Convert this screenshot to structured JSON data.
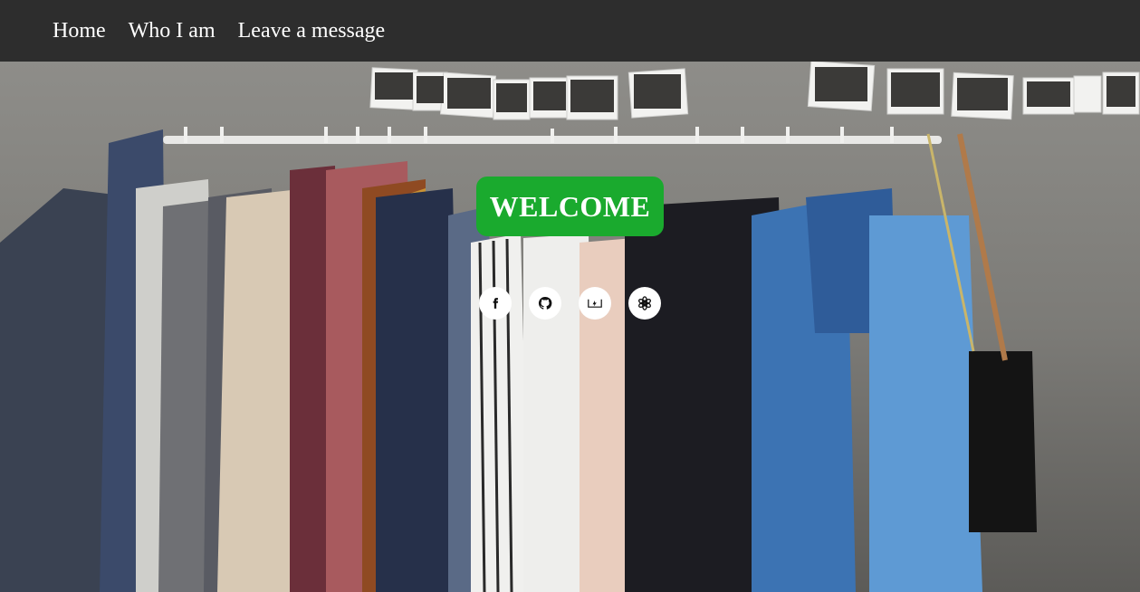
{
  "nav": {
    "items": [
      {
        "label": "Home"
      },
      {
        "label": "Who I am"
      },
      {
        "label": "Leave a message"
      }
    ]
  },
  "hero": {
    "welcome_label": "WELCOME",
    "accent_color": "#1aaa2e",
    "social_icons": [
      "facebook-icon",
      "github-icon",
      "codepen-icon",
      "openai-icon"
    ]
  }
}
